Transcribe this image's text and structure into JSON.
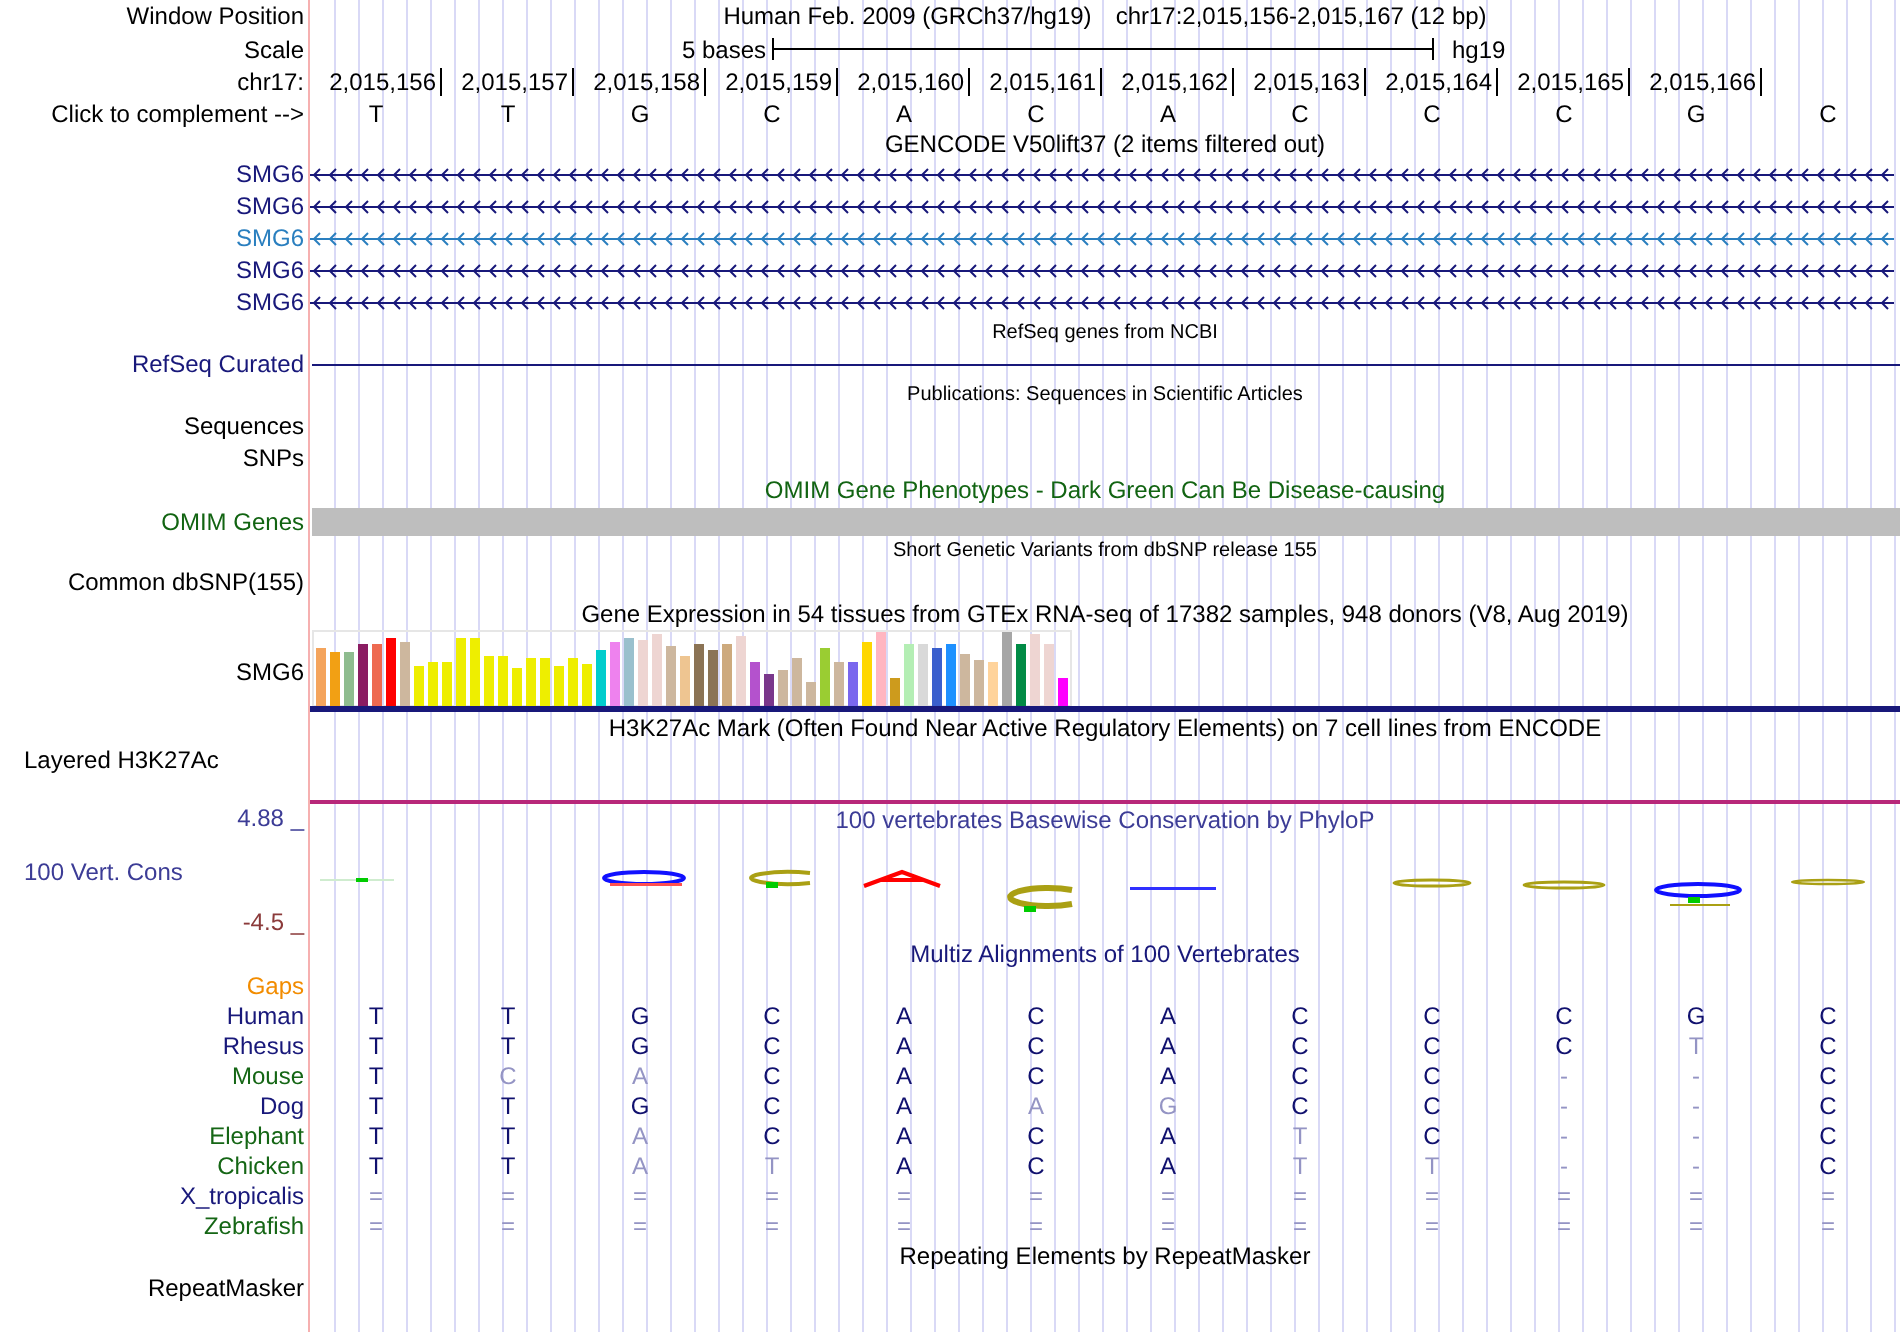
{
  "header": {
    "window_position": {
      "label": "Window Position",
      "assembly": "Human Feb. 2009 (GRCh37/hg19)",
      "range": "chr17:2,015,156-2,015,167 (12 bp)"
    },
    "scale": {
      "label": "Scale",
      "length": "5 bases",
      "assembly": "hg19"
    },
    "ruler": {
      "label": "chr17:",
      "positions": [
        "2,015,156",
        "2,015,157",
        "2,015,158",
        "2,015,159",
        "2,015,160",
        "2,015,161",
        "2,015,162",
        "2,015,163",
        "2,015,164",
        "2,015,165",
        "2,015,166"
      ]
    },
    "sequence": {
      "label": "Click to complement -->",
      "bases": [
        "T",
        "T",
        "G",
        "C",
        "A",
        "C",
        "A",
        "C",
        "C",
        "C",
        "G",
        "C"
      ]
    }
  },
  "tracks": [
    {
      "kind": "genes",
      "title": "GENCODE V50lift37 (2 items filtered out)",
      "color": "#000000",
      "items": [
        {
          "name": "SMG6",
          "color": "#18187a"
        },
        {
          "name": "SMG6",
          "color": "#18187a"
        },
        {
          "name": "SMG6",
          "color": "#2a7fbf"
        },
        {
          "name": "SMG6",
          "color": "#18187a"
        },
        {
          "name": "SMG6",
          "color": "#18187a"
        }
      ]
    },
    {
      "kind": "composite",
      "title": "RefSeq genes from NCBI",
      "color": "#000000",
      "subtracks": [
        {
          "name": "RefSeq Curated",
          "kind": "line",
          "color": "#18187a"
        }
      ]
    },
    {
      "kind": "composite",
      "title": "Publications: Sequences in Scientific Articles",
      "color": "#000000",
      "subtracks": [
        {
          "name": "Sequences",
          "kind": "empty",
          "color": "#000000"
        },
        {
          "name": "SNPs",
          "kind": "empty",
          "color": "#000000"
        }
      ]
    },
    {
      "kind": "bar",
      "title": "OMIM Gene Phenotypes - Dark Green Can Be Disease-causing",
      "color": "#126412",
      "label": "OMIM Genes"
    },
    {
      "kind": "composite",
      "title": "Short Genetic Variants from dbSNP release 155",
      "color": "#000000",
      "subtracks": [
        {
          "name": "Common dbSNP(155)",
          "kind": "empty",
          "color": "#000000"
        }
      ]
    },
    {
      "kind": "expression",
      "title": "Gene Expression in 54 tissues from GTEx RNA-seq of 17382 samples, 948 donors (V8, Aug 2019)",
      "color": "#000000",
      "label": "SMG6"
    },
    {
      "kind": "layered",
      "title": "H3K27Ac Mark (Often Found Near Active Regulatory Elements) on 7 cell lines from ENCODE",
      "color": "#000000",
      "label": "Layered H3K27Ac"
    },
    {
      "kind": "conservation",
      "title": "100 vertebrates Basewise Conservation by PhyloP",
      "color": "#3c3c96",
      "label": "100 Vert. Cons",
      "max": "4.88 _",
      "min": "-4.5 _"
    },
    {
      "kind": "alignment",
      "title": "Multiz Alignments of 100 Vertebrates",
      "color": "#18187a",
      "gaps": {
        "label": "Gaps",
        "color": "#f28c00"
      },
      "species": [
        {
          "name": "Human",
          "color": "#18187a",
          "bases": [
            "T",
            "T",
            "G",
            "C",
            "A",
            "C",
            "A",
            "C",
            "C",
            "C",
            "G",
            "C"
          ],
          "faded": [
            false,
            false,
            false,
            false,
            false,
            false,
            false,
            false,
            false,
            false,
            false,
            false
          ]
        },
        {
          "name": "Rhesus",
          "color": "#18187a",
          "bases": [
            "T",
            "T",
            "G",
            "C",
            "A",
            "C",
            "A",
            "C",
            "C",
            "C",
            "T",
            "C"
          ],
          "faded": [
            false,
            false,
            false,
            false,
            false,
            false,
            false,
            false,
            false,
            false,
            true,
            false
          ]
        },
        {
          "name": "Mouse",
          "color": "#156615",
          "bases": [
            "T",
            "C",
            "A",
            "C",
            "A",
            "C",
            "A",
            "C",
            "C",
            "-",
            "-",
            "C"
          ],
          "faded": [
            false,
            true,
            true,
            false,
            false,
            false,
            false,
            false,
            false,
            true,
            true,
            false
          ]
        },
        {
          "name": "Dog",
          "color": "#18187a",
          "bases": [
            "T",
            "T",
            "G",
            "C",
            "A",
            "A",
            "G",
            "C",
            "C",
            "-",
            "-",
            "C"
          ],
          "faded": [
            false,
            false,
            false,
            false,
            false,
            true,
            true,
            false,
            false,
            true,
            true,
            false
          ]
        },
        {
          "name": "Elephant",
          "color": "#156615",
          "bases": [
            "T",
            "T",
            "A",
            "C",
            "A",
            "C",
            "A",
            "T",
            "C",
            "-",
            "-",
            "C"
          ],
          "faded": [
            false,
            false,
            true,
            false,
            false,
            false,
            false,
            true,
            false,
            true,
            true,
            false
          ]
        },
        {
          "name": "Chicken",
          "color": "#156615",
          "bases": [
            "T",
            "T",
            "A",
            "T",
            "A",
            "C",
            "A",
            "T",
            "T",
            "-",
            "-",
            "C"
          ],
          "faded": [
            false,
            false,
            true,
            true,
            false,
            false,
            false,
            true,
            true,
            true,
            true,
            false
          ]
        },
        {
          "name": "X_tropicalis",
          "color": "#18187a",
          "bases": [
            "=",
            "=",
            "=",
            "=",
            "=",
            "=",
            "=",
            "=",
            "=",
            "=",
            "=",
            "="
          ],
          "faded": [
            true,
            true,
            true,
            true,
            true,
            true,
            true,
            true,
            true,
            true,
            true,
            true
          ]
        },
        {
          "name": "Zebrafish",
          "color": "#156615",
          "bases": [
            "=",
            "=",
            "=",
            "=",
            "=",
            "=",
            "=",
            "=",
            "=",
            "=",
            "=",
            "="
          ],
          "faded": [
            true,
            true,
            true,
            true,
            true,
            true,
            true,
            true,
            true,
            true,
            true,
            true
          ]
        }
      ]
    },
    {
      "kind": "plain",
      "title": "Repeating Elements by RepeatMasker",
      "color": "#000000",
      "label": "RepeatMasker"
    }
  ]
}
